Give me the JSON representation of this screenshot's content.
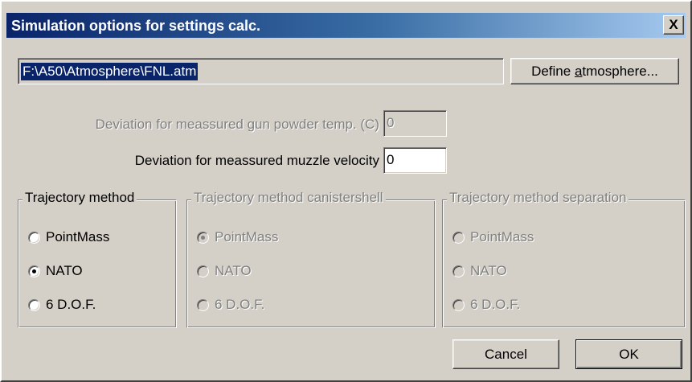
{
  "window": {
    "title": "Simulation options for settings calc.",
    "close_glyph": "X"
  },
  "atmosphere": {
    "path": "F:\\A50\\Atmosphere\\FNL.atm",
    "define_button": {
      "prefix": "Define ",
      "mnemonic": "a",
      "suffix": "tmosphere..."
    }
  },
  "powder_temp": {
    "label": "Deviation for meassured gun powder temp. (C)",
    "value": "0"
  },
  "muzzle_velocity": {
    "label": "Deviation for meassured muzzle velocity",
    "value": "0"
  },
  "groups": [
    {
      "title": "Trajectory method",
      "options": [
        "PointMass",
        "NATO",
        "6 D.O.F."
      ],
      "selected": 1,
      "enabled": true
    },
    {
      "title": "Trajectory method canistershell",
      "options": [
        "PointMass",
        "NATO",
        "6 D.O.F."
      ],
      "selected": 0,
      "enabled": false
    },
    {
      "title": "Trajectory method separation",
      "options": [
        "PointMass",
        "NATO",
        "6 D.O.F."
      ],
      "selected": -1,
      "enabled": false
    }
  ],
  "buttons": {
    "cancel": "Cancel",
    "ok": "OK"
  }
}
